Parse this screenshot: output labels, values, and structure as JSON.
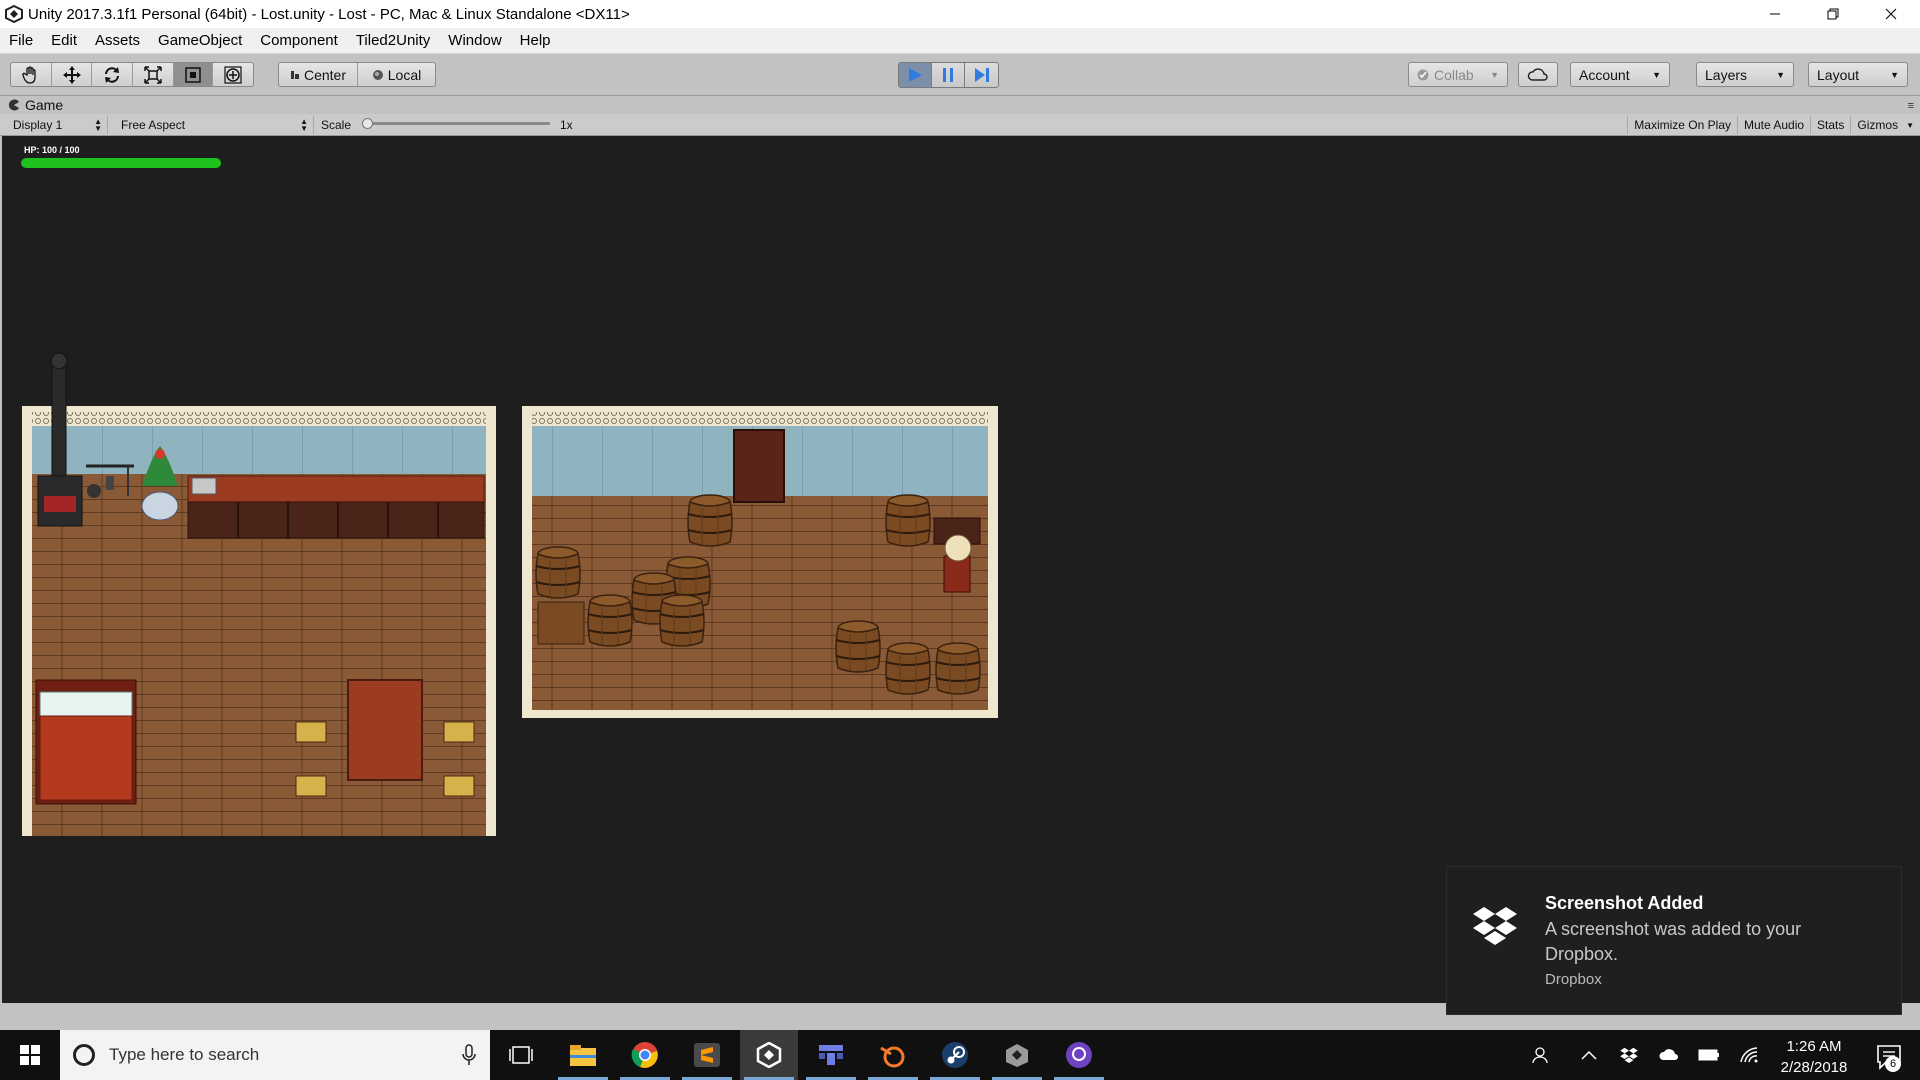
{
  "window": {
    "title": "Unity 2017.3.1f1 Personal (64bit) - Lost.unity - Lost - PC, Mac & Linux Standalone <DX11>",
    "controls": [
      "minimize-icon",
      "restore-icon",
      "close-icon"
    ]
  },
  "menu": [
    "File",
    "Edit",
    "Assets",
    "GameObject",
    "Component",
    "Tiled2Unity",
    "Window",
    "Help"
  ],
  "toolbar": {
    "tools": [
      "hand-icon",
      "move-icon",
      "rotate-icon",
      "scale-icon",
      "rect-tool-icon",
      "transform-tool-icon"
    ],
    "pivot_label": "Center",
    "space_label": "Local",
    "play_controls": [
      "play-icon",
      "pause-icon",
      "step-icon"
    ],
    "collab_label": "Collab",
    "account_label": "Account",
    "layers_label": "Layers",
    "layout_label": "Layout"
  },
  "game_tab": {
    "label": "Game",
    "display": "Display 1",
    "aspect": "Free Aspect",
    "scale_label": "Scale",
    "scale_value": "1x",
    "scale_level": 0.0,
    "maximize_on_play": "Maximize On Play",
    "mute_audio": "Mute Audio",
    "stats": "Stats",
    "gizmos": "Gizmos"
  },
  "hud": {
    "hp_text": "HP: 100 / 100",
    "hp_fraction": 1.0,
    "hp_color": "#1dc21d"
  },
  "toast": {
    "title": "Screenshot Added",
    "body": "A screenshot was added to your Dropbox.",
    "source": "Dropbox",
    "icon": "dropbox-icon"
  },
  "taskbar": {
    "search_placeholder": "Type here to search",
    "apps": [
      "task-view-icon",
      "file-explorer-icon",
      "chrome-icon",
      "sublime-text-icon",
      "unity-icon",
      "tiled-icon",
      "blender-icon",
      "steam-icon",
      "unity-hub-icon",
      "github-desktop-icon"
    ],
    "tray": [
      "people-icon",
      "chevron-up-icon",
      "dropbox-tray-icon",
      "onedrive-icon",
      "battery-icon",
      "wifi-icon"
    ],
    "time": "1:26 AM",
    "date": "2/28/2018",
    "notification_count": "6"
  },
  "colors": {
    "accent": "#3b7bd8",
    "editor_gray": "#c2c2c2",
    "game_bg": "#1e1e1e",
    "wood_floor": "#8a5a36",
    "wall_blue": "#8fb3bf"
  }
}
